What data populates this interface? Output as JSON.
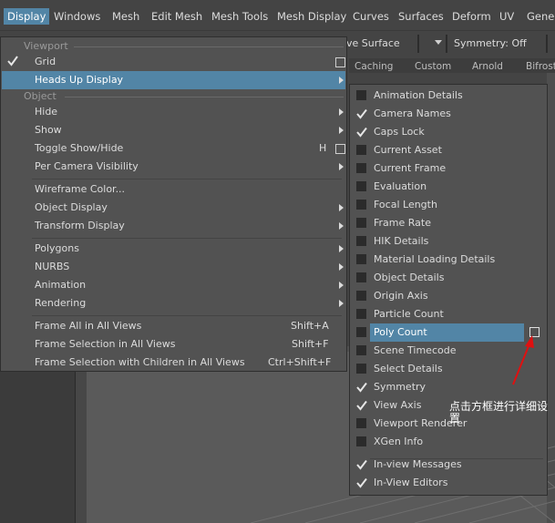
{
  "menubar": {
    "items": [
      "Display",
      "Windows",
      "Mesh",
      "Edit Mesh",
      "Mesh Tools",
      "Mesh Display",
      "Curves",
      "Surfaces",
      "Deform",
      "UV",
      "Gener"
    ],
    "active": "Display"
  },
  "toolbar": {
    "surface_label": "ve Surface",
    "symmetry_label": "Symmetry: Off"
  },
  "shelf_tabs": [
    "Caching",
    "Custom",
    "Arnold",
    "Bifrost"
  ],
  "main_menu": {
    "viewport_header": "Viewport",
    "object_header": "Object",
    "items": {
      "grid": "Grid",
      "heads_up_display": "Heads Up Display",
      "hide": "Hide",
      "show": "Show",
      "toggle_show_hide": "Toggle Show/Hide",
      "toggle_hotkey": "H",
      "per_camera_visibility": "Per Camera Visibility",
      "wireframe_color": "Wireframe Color...",
      "object_display": "Object Display",
      "transform_display": "Transform Display",
      "polygons": "Polygons",
      "nurbs": "NURBS",
      "animation": "Animation",
      "rendering": "Rendering",
      "frame_all": "Frame All in All Views",
      "frame_all_hotkey": "Shift+A",
      "frame_selection": "Frame Selection in All Views",
      "frame_selection_hotkey": "Shift+F",
      "frame_selection_children": "Frame Selection with Children in All Views",
      "frame_selection_children_hotkey": "Ctrl+Shift+F"
    },
    "grid_checked": true
  },
  "hud_menu": {
    "items": [
      {
        "label": "Animation Details",
        "checked": false
      },
      {
        "label": "Camera Names",
        "checked": true
      },
      {
        "label": "Caps Lock",
        "checked": true
      },
      {
        "label": "Current Asset",
        "checked": false
      },
      {
        "label": "Current Frame",
        "checked": false
      },
      {
        "label": "Evaluation",
        "checked": false
      },
      {
        "label": "Focal Length",
        "checked": false
      },
      {
        "label": "Frame Rate",
        "checked": false
      },
      {
        "label": "HIK Details",
        "checked": false
      },
      {
        "label": "Material Loading Details",
        "checked": false
      },
      {
        "label": "Object Details",
        "checked": false
      },
      {
        "label": "Origin Axis",
        "checked": false
      },
      {
        "label": "Particle Count",
        "checked": false
      },
      {
        "label": "Poly Count",
        "checked": false,
        "highlighted": true
      },
      {
        "label": "Scene Timecode",
        "checked": false
      },
      {
        "label": "Select Details",
        "checked": false
      },
      {
        "label": "Symmetry",
        "checked": true
      },
      {
        "label": "View Axis",
        "checked": true
      },
      {
        "label": "Viewport Renderer",
        "checked": false
      },
      {
        "label": "XGen Info",
        "checked": false
      }
    ],
    "extra_items": [
      {
        "label": "In-view Messages",
        "checked": true
      },
      {
        "label": "In-View Editors",
        "checked": true
      }
    ]
  },
  "annotation": {
    "text": "点击方框进行详细设置",
    "color": "#e01010"
  },
  "colors": {
    "highlight": "#5285a6",
    "menu_bg": "#525252",
    "app_bg": "#444444"
  }
}
